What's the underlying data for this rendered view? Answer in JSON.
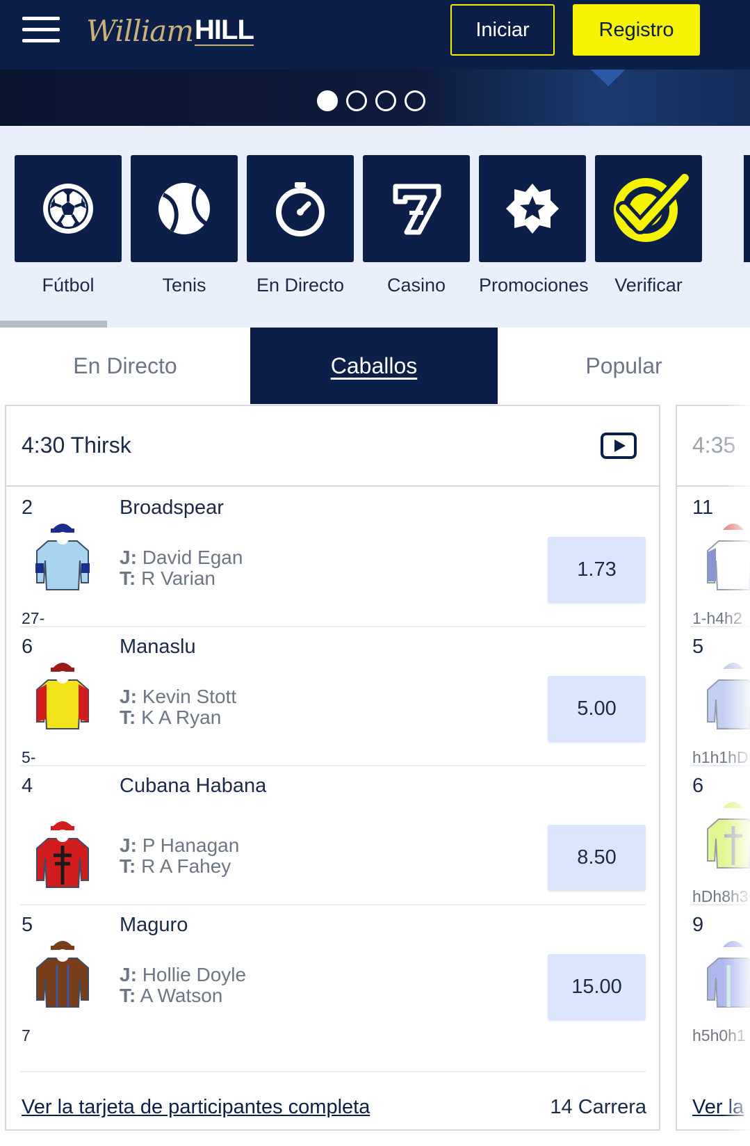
{
  "header": {
    "logo_script": "William",
    "logo_bold": "HILL",
    "login_label": "Iniciar",
    "register_label": "Registro"
  },
  "banner": {
    "slides": 4,
    "active_slide": 1
  },
  "categories": [
    {
      "label": "Fútbol",
      "icon": "soccer-ball-icon"
    },
    {
      "label": "Tenis",
      "icon": "tennis-ball-icon"
    },
    {
      "label": "En Directo",
      "icon": "stopwatch-icon"
    },
    {
      "label": "Casino",
      "icon": "lucky-seven-icon"
    },
    {
      "label": "Promociones",
      "icon": "star-badge-icon"
    },
    {
      "label": "Verificar",
      "icon": "check-verify-icon"
    }
  ],
  "tabs": [
    {
      "label": "En Directo",
      "active": false
    },
    {
      "label": "Caballos",
      "active": true
    },
    {
      "label": "Popular",
      "active": false
    }
  ],
  "race": {
    "title": "4:30 Thirsk",
    "runners": [
      {
        "number": "2",
        "name": "Broadspear",
        "jockey_prefix": "J:",
        "jockey": "David Egan",
        "trainer_prefix": "T:",
        "trainer": "R Varian",
        "form": "27-",
        "odds": "1.73",
        "silk_body": "#a9d4ef",
        "silk_cap": "#1b2f8a"
      },
      {
        "number": "6",
        "name": "Manaslu",
        "jockey_prefix": "J:",
        "jockey": "Kevin Stott",
        "trainer_prefix": "T:",
        "trainer": "K A Ryan",
        "form": "5-",
        "odds": "5.00",
        "silk_body": "#f2e21a",
        "silk_cap": "#9b1b1b"
      },
      {
        "number": "4",
        "name": "Cubana Habana",
        "jockey_prefix": "J:",
        "jockey": "P Hanagan",
        "trainer_prefix": "T:",
        "trainer": "R A Fahey",
        "form": "",
        "odds": "8.50",
        "silk_body": "#d11d1d",
        "silk_cap": "#d11d1d"
      },
      {
        "number": "5",
        "name": "Maguro",
        "jockey_prefix": "J:",
        "jockey": "Hollie Doyle",
        "trainer_prefix": "T:",
        "trainer": "A Watson",
        "form": "7",
        "odds": "15.00",
        "silk_body": "#7a3d1a",
        "silk_cap": "#7a3d1a"
      }
    ],
    "footer_link": "Ver la tarjeta de participantes completa",
    "race_count": "14 Carrera"
  },
  "next_race": {
    "title": "4:35",
    "runners": [
      {
        "number": "11",
        "form": "1-h4h2"
      },
      {
        "number": "5",
        "form": "h1h1hD"
      },
      {
        "number": "6",
        "form": "hDh8h3"
      },
      {
        "number": "9",
        "form": "h5h0h1"
      }
    ],
    "footer_link": "Ver la"
  },
  "colors": {
    "navy": "#0b1f49",
    "yellow": "#f5f300",
    "odds_bg": "#dbe5fc",
    "category_bg": "#eaf0fb"
  }
}
